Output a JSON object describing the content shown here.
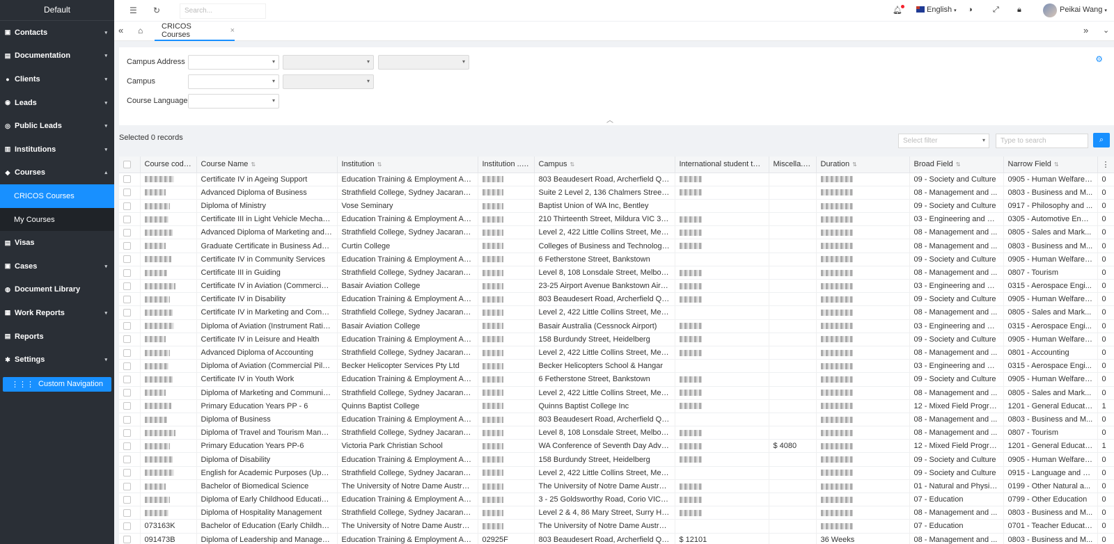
{
  "sidebar": {
    "title": "Default",
    "items": [
      {
        "label": "Contacts",
        "icon": "contacts-icon",
        "glyph": "▣",
        "caret": "▾"
      },
      {
        "label": "Documentation",
        "icon": "documentation-icon",
        "glyph": "▤",
        "caret": "▾"
      },
      {
        "label": "Clients",
        "icon": "clients-icon",
        "glyph": "●",
        "caret": "▾"
      },
      {
        "label": "Leads",
        "icon": "leads-icon",
        "glyph": "◉",
        "caret": "▾"
      },
      {
        "label": "Public Leads",
        "icon": "public-leads-icon",
        "glyph": "◎",
        "caret": "▾"
      },
      {
        "label": "Institutions",
        "icon": "institutions-icon",
        "glyph": "▥",
        "caret": "▾"
      },
      {
        "label": "Courses",
        "icon": "courses-icon",
        "glyph": "◆",
        "caret": "▴"
      }
    ],
    "subitems": [
      {
        "label": "CRICOS Courses",
        "active": true
      },
      {
        "label": "My Courses",
        "active": false
      }
    ],
    "items2": [
      {
        "label": "Visas",
        "icon": "visas-icon",
        "glyph": "▤",
        "caret": ""
      },
      {
        "label": "Cases",
        "icon": "cases-icon",
        "glyph": "▣",
        "caret": "▾"
      },
      {
        "label": "Document Library",
        "icon": "document-library-icon",
        "glyph": "◍",
        "caret": ""
      },
      {
        "label": "Work Reports",
        "icon": "work-reports-icon",
        "glyph": "▦",
        "caret": "▾"
      },
      {
        "label": "Reports",
        "icon": "reports-icon",
        "glyph": "▤",
        "caret": ""
      },
      {
        "label": "Settings",
        "icon": "settings-icon",
        "glyph": "✱",
        "caret": "▾"
      }
    ],
    "custom_nav": "Custom Navigation"
  },
  "topbar": {
    "search_placeholder": "Search...",
    "language": "English",
    "user": "Peikai Wang"
  },
  "tabs": {
    "active": "CRICOS Courses"
  },
  "filters": {
    "campus_address": "Campus Address",
    "campus": "Campus",
    "course_language": "Course Language"
  },
  "toolbar": {
    "selected": "Selected 0 records",
    "select_filter": "Select filter",
    "type_to_search": "Type to search"
  },
  "table": {
    "columns": [
      "Course code",
      "Course Name",
      "Institution",
      "Institution ...",
      "Campus",
      "International student tui...",
      "Miscella...",
      "Duration",
      "Broad Field",
      "Narrow Field"
    ],
    "rows": [
      {
        "code": "",
        "name": "Certificate IV in Ageing Support",
        "inst": "Education Training & Employment Aus...",
        "campus": "803 Beaudesert Road, Archerfield QL...",
        "misc": "",
        "broad": "09 - Society and Culture",
        "narrow": "0905 - Human Welfare ...",
        "extra": "0"
      },
      {
        "code": "",
        "name": "Advanced Diploma of Business",
        "inst": "Strathfield College, Sydney Jacaranda...",
        "campus": "Suite 2 Level 2, 136 Chalmers Street, ...",
        "misc": "",
        "broad": "08 - Management and ...",
        "narrow": "0803 - Business and M...",
        "extra": "0"
      },
      {
        "code": "",
        "name": "Diploma of Ministry",
        "inst": "Vose Seminary",
        "campus": "Baptist Union of WA Inc, Bentley",
        "misc": "",
        "broad": "09 - Society and Culture",
        "narrow": "0917 - Philosophy and ...",
        "extra": "0"
      },
      {
        "code": "",
        "name": "Certificate III in Light Vehicle Mechanic...",
        "inst": "Education Training & Employment Aus...",
        "campus": "210 Thirteenth Street, Mildura VIC 3500",
        "misc": "",
        "broad": "03 - Engineering and R...",
        "narrow": "0305 - Automotive Engi...",
        "extra": "0"
      },
      {
        "code": "",
        "name": "Advanced Diploma of Marketing and C...",
        "inst": "Strathfield College, Sydney Jacaranda...",
        "campus": "Level 2, 422 Little Collins Street, Melb...",
        "misc": "",
        "broad": "08 - Management and ...",
        "narrow": "0805 - Sales and Mark...",
        "extra": "0"
      },
      {
        "code": "",
        "name": "Graduate Certificate in Business Admi...",
        "inst": "Curtin College",
        "campus": "Colleges of Business and Technology (...",
        "misc": "",
        "broad": "08 - Management and ...",
        "narrow": "0803 - Business and M...",
        "extra": "0"
      },
      {
        "code": "",
        "name": "Certificate IV in Community Services",
        "inst": "Education Training & Employment Aus...",
        "campus": "6 Fetherstone Street, Bankstown",
        "misc": "",
        "broad": "09 - Society and Culture",
        "narrow": "0905 - Human Welfare ...",
        "extra": "0"
      },
      {
        "code": "",
        "name": "Certificate III in Guiding",
        "inst": "Strathfield College, Sydney Jacaranda...",
        "campus": "Level 8, 108 Lonsdale Street, Melbourne",
        "misc": "",
        "broad": "08 - Management and ...",
        "narrow": "0807 - Tourism",
        "extra": "0"
      },
      {
        "code": "",
        "name": "Certificate IV in Aviation (Commercial ...",
        "inst": "Basair Aviation College",
        "campus": "23-25 Airport Avenue Bankstown Airpo...",
        "misc": "",
        "broad": "03 - Engineering and R...",
        "narrow": "0315 - Aerospace Engi...",
        "extra": "0"
      },
      {
        "code": "",
        "name": "Certificate IV in Disability",
        "inst": "Education Training & Employment Aus...",
        "campus": "803 Beaudesert Road, Archerfield QL...",
        "misc": "",
        "broad": "09 - Society and Culture",
        "narrow": "0905 - Human Welfare ...",
        "extra": "0"
      },
      {
        "code": "",
        "name": "Certificate IV in Marketing and Commu...",
        "inst": "Strathfield College, Sydney Jacaranda...",
        "campus": "Level 2, 422 Little Collins Street, Melb...",
        "misc": "",
        "broad": "08 - Management and ...",
        "narrow": "0805 - Sales and Mark...",
        "extra": "0"
      },
      {
        "code": "",
        "name": "Diploma of Aviation (Instrument Rating)",
        "inst": "Basair Aviation College",
        "campus": "Basair Australia (Cessnock Airport)",
        "misc": "",
        "broad": "03 - Engineering and R...",
        "narrow": "0315 - Aerospace Engi...",
        "extra": "0"
      },
      {
        "code": "",
        "name": "Certificate IV in Leisure and Health",
        "inst": "Education Training & Employment Aus...",
        "campus": "158 Burdundy Street, Heidelberg",
        "misc": "",
        "broad": "09 - Society and Culture",
        "narrow": "0905 - Human Welfare ...",
        "extra": "0"
      },
      {
        "code": "",
        "name": "Advanced Diploma of Accounting",
        "inst": "Strathfield College, Sydney Jacaranda...",
        "campus": "Level 2, 422 Little Collins Street, Melb...",
        "misc": "",
        "broad": "08 - Management and ...",
        "narrow": "0801 - Accounting",
        "extra": "0"
      },
      {
        "code": "",
        "name": "Diploma of Aviation (Commercial Pilot ...",
        "inst": "Becker Helicopter Services Pty Ltd",
        "campus": "Becker Helicopters School & Hangar",
        "misc": "",
        "broad": "03 - Engineering and R...",
        "narrow": "0315 - Aerospace Engi...",
        "extra": "0"
      },
      {
        "code": "",
        "name": "Certificate IV in Youth Work",
        "inst": "Education Training & Employment Aus...",
        "campus": "6 Fetherstone Street, Bankstown",
        "misc": "",
        "broad": "09 - Society and Culture",
        "narrow": "0905 - Human Welfare ...",
        "extra": "0"
      },
      {
        "code": "",
        "name": "Diploma of Marketing and Communica...",
        "inst": "Strathfield College, Sydney Jacaranda...",
        "campus": "Level 2, 422 Little Collins Street, Melb...",
        "misc": "",
        "broad": "08 - Management and ...",
        "narrow": "0805 - Sales and Mark...",
        "extra": "0"
      },
      {
        "code": "",
        "name": "Primary Education Years PP - 6",
        "inst": "Quinns Baptist College",
        "campus": "Quinns Baptist College Inc",
        "misc": "",
        "broad": "12 - Mixed Field Progra...",
        "narrow": "1201 - General Educati...",
        "extra": "1"
      },
      {
        "code": "",
        "name": "Diploma of Business",
        "inst": "Education Training & Employment Aus...",
        "campus": "803 Beaudesert Road, Archerfield QL...",
        "misc": "",
        "broad": "08 - Management and ...",
        "narrow": "0803 - Business and M...",
        "extra": "0"
      },
      {
        "code": "",
        "name": "Diploma of Travel and Tourism Manag...",
        "inst": "Strathfield College, Sydney Jacaranda...",
        "campus": "Level 8, 108 Lonsdale Street, Melbourne",
        "misc": "",
        "broad": "08 - Management and ...",
        "narrow": "0807 - Tourism",
        "extra": "0"
      },
      {
        "code": "",
        "name": "Primary Education Years PP-6",
        "inst": "Victoria Park Christian School",
        "campus": "WA Conference of Seventh Day Adve...",
        "misc": "$ 4080",
        "broad": "12 - Mixed Field Progra...",
        "narrow": "1201 - General Educati...",
        "extra": "1"
      },
      {
        "code": "",
        "name": "Diploma of Disability",
        "inst": "Education Training & Employment Aus...",
        "campus": "158 Burdundy Street, Heidelberg",
        "misc": "",
        "broad": "09 - Society and Culture",
        "narrow": "0905 - Human Welfare ...",
        "extra": "0"
      },
      {
        "code": "",
        "name": "English for Academic Purposes (Upper...",
        "inst": "Strathfield College, Sydney Jacaranda...",
        "campus": "Level 2, 422 Little Collins Street, Melb...",
        "misc": "",
        "broad": "09 - Society and Culture",
        "narrow": "0915 - Language and L...",
        "extra": "0"
      },
      {
        "code": "",
        "name": "Bachelor of Biomedical Science",
        "inst": "The University of Notre Dame Australia",
        "campus": "The University of Notre Dame Australi...",
        "misc": "",
        "broad": "01 - Natural and Physic...",
        "narrow": "0199 - Other Natural a...",
        "extra": "0"
      },
      {
        "code": "",
        "name": "Diploma of Early Childhood Education ...",
        "inst": "Education Training & Employment Aus...",
        "campus": "3 - 25 Goldsworthy Road, Corio VIC 3...",
        "misc": "",
        "broad": "07 - Education",
        "narrow": "0799 - Other Education",
        "extra": "0"
      },
      {
        "code": "",
        "name": "Diploma of Hospitality Management",
        "inst": "Strathfield College, Sydney Jacaranda...",
        "campus": "Level 2 & 4, 86 Mary Street, Surry Hills...",
        "misc": "",
        "broad": "08 - Management and ...",
        "narrow": "0803 - Business and M...",
        "extra": "0"
      },
      {
        "code": "073163K",
        "name": "Bachelor of Education (Early Childhoo...",
        "inst": "The University of Notre Dame Australia",
        "campus": "The University of Notre Dame Australi...",
        "misc": "",
        "broad": "07 - Education",
        "narrow": "0701 - Teacher Education",
        "extra": "0"
      },
      {
        "code": "091473B",
        "name": "Diploma of Leadership and Management",
        "inst": "Education Training & Employment Aus...",
        "campus": "803 Beaudesert Road, Archerfield QL...",
        "misc": "",
        "broad": "08 - Management and ...",
        "narrow": "0803 - Business and M...",
        "extra": "0",
        "inst_code": "02925F",
        "tuition": "$ 12101",
        "duration": "36 Weeks"
      }
    ]
  }
}
